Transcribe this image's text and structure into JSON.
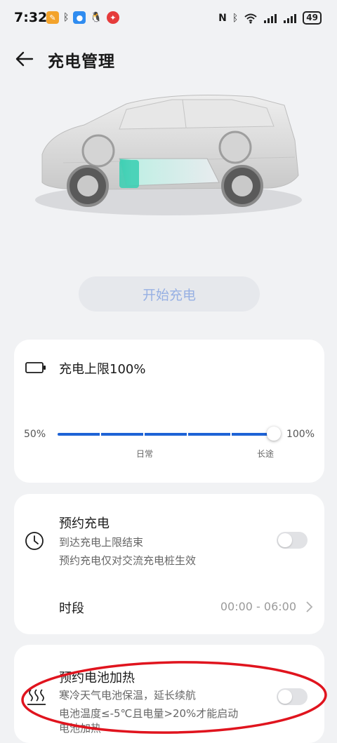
{
  "status_bar": {
    "time": "7:32",
    "battery": "49",
    "icons": [
      "notes-app-icon",
      "bluetooth-small-icon",
      "message-app-icon",
      "qq-icon",
      "red-app-icon",
      "nfc-icon",
      "bluetooth-icon",
      "wifi-icon",
      "signal-icon",
      "signal-icon-2",
      "battery-icon"
    ]
  },
  "header": {
    "title": "充电管理"
  },
  "main": {
    "start_button": "开始充电",
    "charge_limit": {
      "label": "充电上限100%",
      "min_label": "50%",
      "max_label": "100%",
      "daily_label": "日常",
      "long_label": "长途",
      "value": 100
    },
    "schedule": {
      "title": "预约充电",
      "sub1": "到达充电上限结束",
      "sub2": "预约充电仅对交流充电桩生效",
      "toggle_on": false,
      "period_label": "时段",
      "period_value": "00:00 - 06:00"
    },
    "heating": {
      "title": "预约电池加热",
      "sub1": "寒冷天气电池保温，延长续航",
      "sub2": "电池温度≤-5℃且电量>20%才能启动",
      "sub3": "电池加热",
      "toggle_on": false
    }
  },
  "colors": {
    "accent": "#1e63d6",
    "start_button_text": "#97b0e3",
    "annotation": "#e0141e",
    "background": "#f1f2f4"
  }
}
